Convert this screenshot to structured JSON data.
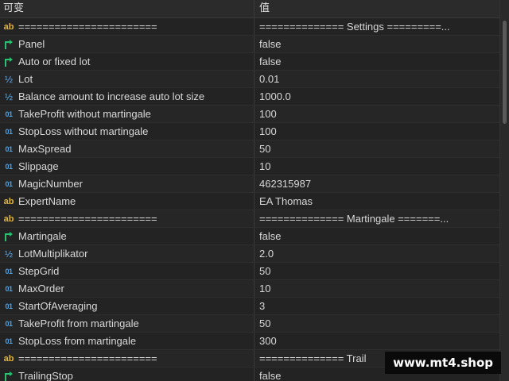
{
  "header": {
    "name_col": "可变",
    "value_col": "值"
  },
  "rows": [
    {
      "icon": "ab",
      "name": "=======================",
      "value": "============== Settings =========..."
    },
    {
      "icon": "bool",
      "name": "Panel",
      "value": "false"
    },
    {
      "icon": "bool",
      "name": "Auto or fixed lot",
      "value": "false"
    },
    {
      "icon": "half",
      "name": "Lot",
      "value": "0.01"
    },
    {
      "icon": "half",
      "name": "Balance amount to increase auto lot size",
      "value": "1000.0"
    },
    {
      "icon": "num",
      "name": "TakeProfit without martingale",
      "value": "100"
    },
    {
      "icon": "num",
      "name": "StopLoss without martingale",
      "value": "100"
    },
    {
      "icon": "num",
      "name": "MaxSpread",
      "value": "50"
    },
    {
      "icon": "num",
      "name": "Slippage",
      "value": "10"
    },
    {
      "icon": "num",
      "name": "MagicNumber",
      "value": "462315987"
    },
    {
      "icon": "ab",
      "name": "ExpertName",
      "value": "EA Thomas"
    },
    {
      "icon": "ab",
      "name": "=======================",
      "value": "============== Martingale =======..."
    },
    {
      "icon": "bool",
      "name": "Martingale",
      "value": "false"
    },
    {
      "icon": "half",
      "name": "LotMultiplikator",
      "value": "2.0"
    },
    {
      "icon": "num",
      "name": "StepGrid",
      "value": "50"
    },
    {
      "icon": "num",
      "name": "MaxOrder",
      "value": "10"
    },
    {
      "icon": "num",
      "name": "StartOfAveraging",
      "value": "3"
    },
    {
      "icon": "num",
      "name": "TakeProfit from martingale",
      "value": "50"
    },
    {
      "icon": "num",
      "name": "StopLoss from martingale",
      "value": "300"
    },
    {
      "icon": "ab",
      "name": "=======================",
      "value": "============== Trail"
    },
    {
      "icon": "bool",
      "name": "TrailingStop",
      "value": "false"
    }
  ],
  "icons": {
    "ab": {
      "glyph": "ab",
      "name": "string-type-icon",
      "color": "#e0b341"
    },
    "num": {
      "glyph": "01",
      "name": "integer-type-icon",
      "color": "#4da3e6"
    },
    "half": {
      "glyph": "½",
      "name": "double-type-icon",
      "color": "#5fb0ef"
    },
    "bool": {
      "glyph": "",
      "name": "boolean-type-icon",
      "color": "#2fbf71"
    }
  },
  "watermark": "www.mt4.shop"
}
